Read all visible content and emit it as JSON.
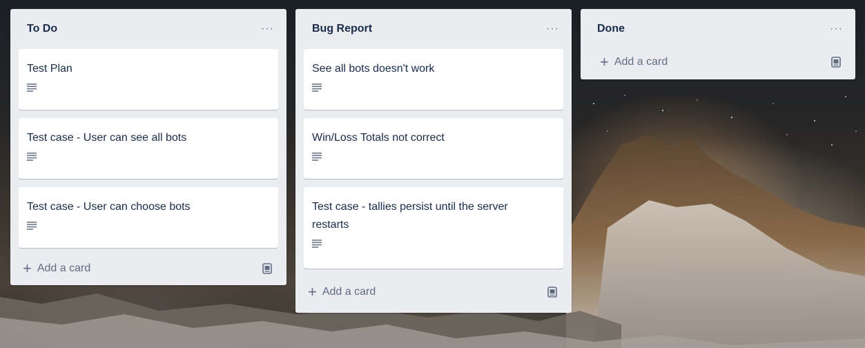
{
  "lists": [
    {
      "title": "To Do",
      "menu_label": "···",
      "cards": [
        {
          "title": "Test Plan",
          "icon": "description-icon"
        },
        {
          "title": "Test case - User can see all bots",
          "icon": "description-icon"
        },
        {
          "title": "Test case - User can choose bots",
          "icon": "description-icon"
        }
      ],
      "add_card_label": "Add a card"
    },
    {
      "title": "Bug Report",
      "menu_label": "···",
      "cards": [
        {
          "title": "See all bots doesn't work",
          "icon": "description-icon"
        },
        {
          "title": "Win/Loss Totals not correct",
          "icon": "description-icon"
        },
        {
          "title": "Test case - tallies persist until the server restarts",
          "icon": "description-icon"
        }
      ],
      "add_card_label": "Add a card"
    },
    {
      "title": "Done",
      "menu_label": "···",
      "cards": [],
      "add_card_label": "Add a card"
    }
  ],
  "colors": {
    "list_background": "#ebecf0",
    "card_background": "#ffffff",
    "title_text": "#172b4d",
    "muted_text": "#5e6c84"
  }
}
